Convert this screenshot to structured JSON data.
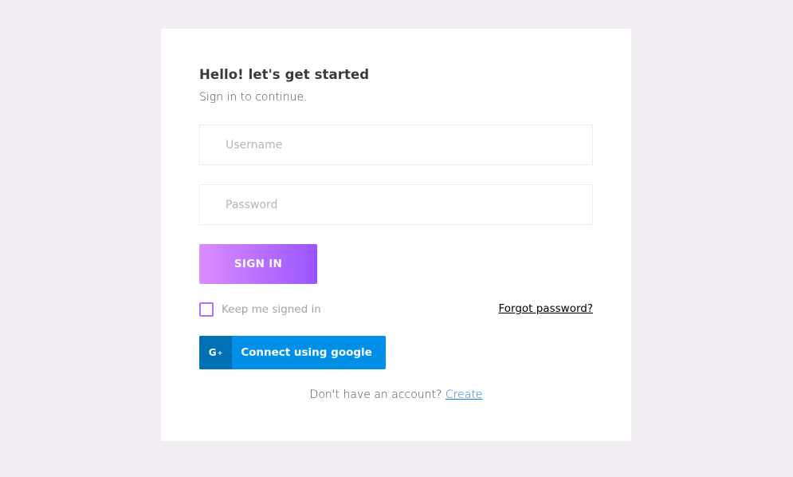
{
  "login": {
    "heading": "Hello! let's get started",
    "subheading": "Sign in to continue.",
    "username_placeholder": "Username",
    "password_placeholder": "Password",
    "signin_label": "SIGN IN",
    "keep_signed_in_label": "Keep me signed in",
    "forgot_password_label": "Forgot password?",
    "google_icon_text": "G",
    "google_icon_plus": "+",
    "google_button_label": "Connect using google",
    "no_account_text": "Don't have an account?",
    "create_link_label": "Create"
  },
  "colors": {
    "background": "#f2edf3",
    "card": "#ffffff",
    "gradient_start": "#da8cff",
    "gradient_end": "#9a55ff",
    "google_blue": "#0090e7",
    "google_icon_bg": "#0071b5",
    "link_blue": "#1f7ae0"
  },
  "icons": {
    "google": "google-plus-icon",
    "checkbox": "checkbox-unchecked"
  }
}
